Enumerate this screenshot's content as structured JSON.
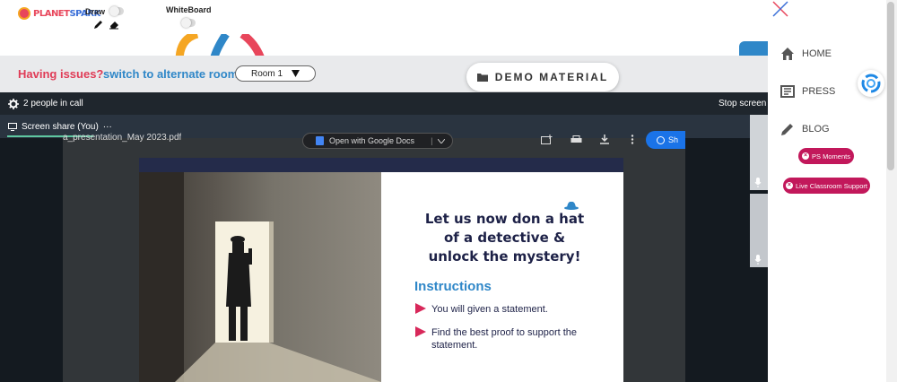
{
  "app": {
    "logo_text_a": "PLANET",
    "logo_text_b": "SPARK",
    "draw_label": "Draw",
    "whiteboard_label": "WhiteBoard"
  },
  "banner": {
    "issues_text": "Having issues?",
    "switch_text": "switch to alternate room",
    "room_selected": "Room 1",
    "demo_material_label": "DEMO MATERIAL"
  },
  "call": {
    "people_count_text": "2 people in call",
    "stop_share_text": "Stop screen",
    "screen_share_label": "Screen share (You)",
    "more_glyph": "···"
  },
  "pdf": {
    "filename": "a_presentation_May 2023.pdf",
    "open_with_label": "Open with Google Docs",
    "share_label": "Sh"
  },
  "slide": {
    "title_lines": [
      "Let us now don a hat",
      "of a detective &",
      "unlock the  mystery!"
    ],
    "instructions_title": "Instructions",
    "bullets": [
      "You will given a statement.",
      "Find the best proof to support the statement."
    ]
  },
  "sidebar": {
    "items": [
      {
        "label": "HOME",
        "icon": "home-icon"
      },
      {
        "label": "PRESS",
        "icon": "newspaper-icon"
      },
      {
        "label": "BLOG",
        "icon": "pencil-icon"
      }
    ],
    "ps_moments_label": "PS Moments",
    "live_support_label": "Live Classroom Support"
  },
  "colors": {
    "brand_red": "#e8465b",
    "brand_blue": "#2f87c8",
    "pill_magenta": "#c2185b",
    "slide_navy": "#1d2147"
  }
}
